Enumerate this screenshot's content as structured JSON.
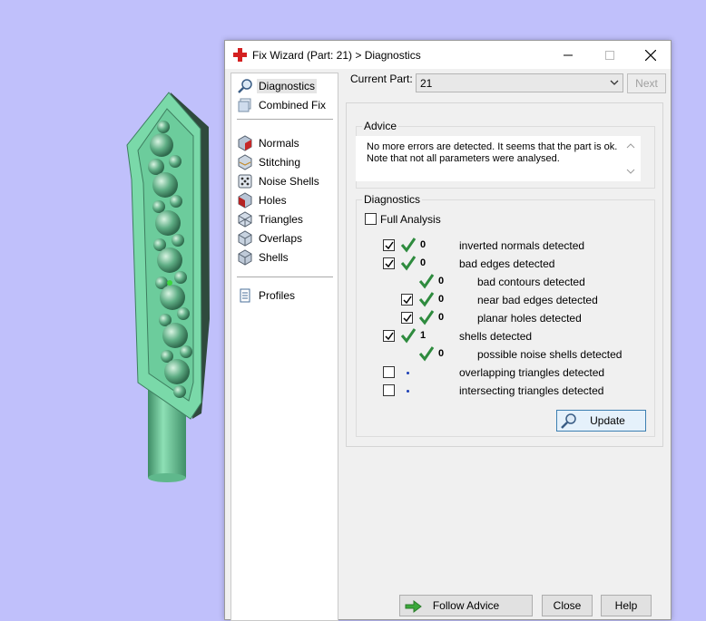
{
  "window": {
    "title": "Fix Wizard (Part: 21) > Diagnostics",
    "minimize_icon": "minimize-icon",
    "maximize_icon": "maximize-icon",
    "close_icon": "close-icon"
  },
  "sidebar": {
    "items": [
      {
        "label": "Diagnostics",
        "icon": "magnifier-icon",
        "selected": true
      },
      {
        "label": "Combined Fix",
        "icon": "cube-stack-icon"
      },
      {
        "label": "Normals",
        "icon": "cube-red-face-icon"
      },
      {
        "label": "Stitching",
        "icon": "cube-stitch-icon"
      },
      {
        "label": "Noise Shells",
        "icon": "dice-icon"
      },
      {
        "label": "Holes",
        "icon": "cube-hole-icon"
      },
      {
        "label": "Triangles",
        "icon": "triangles-cube-icon"
      },
      {
        "label": "Overlaps",
        "icon": "overlaps-cube-icon"
      },
      {
        "label": "Shells",
        "icon": "shells-cube-icon"
      },
      {
        "label": "Profiles",
        "icon": "document-icon"
      }
    ]
  },
  "current_part": {
    "label": "Current Part:",
    "value": "21"
  },
  "next_button": "Next",
  "advice": {
    "title": "Advice",
    "text": "No more errors are detected. It seems that the part is ok.\nNote that not all parameters were analysed."
  },
  "diagnostics": {
    "title": "Diagnostics",
    "full_analysis": {
      "label": "Full Analysis",
      "checked": false
    },
    "rows": [
      {
        "checked": true,
        "status": "ok",
        "count": "0",
        "label": "inverted normals detected",
        "level": 0
      },
      {
        "checked": true,
        "status": "ok",
        "count": "0",
        "label": "bad edges detected",
        "level": 0
      },
      {
        "checkbox": false,
        "status": "ok",
        "count": "0",
        "label": "bad contours detected",
        "level": 1
      },
      {
        "checked": true,
        "status": "ok",
        "count": "0",
        "label": "near bad edges detected",
        "level": 1
      },
      {
        "checked": true,
        "status": "ok",
        "count": "0",
        "label": "planar holes detected",
        "level": 1
      },
      {
        "checked": true,
        "status": "ok",
        "count": "1",
        "label": "shells detected",
        "level": 0
      },
      {
        "checkbox": false,
        "status": "ok",
        "count": "0",
        "label": "possible noise shells detected",
        "level": 1
      },
      {
        "checked": false,
        "status": "not-analysed",
        "count": "",
        "label": "overlapping triangles detected",
        "level": 0
      },
      {
        "checked": false,
        "status": "not-analysed",
        "count": "",
        "label": "intersecting triangles detected",
        "level": 0
      }
    ],
    "update_button": "Update"
  },
  "footer": {
    "follow_advice": "Follow Advice",
    "close": "Close",
    "help": "Help"
  },
  "colors": {
    "background": "#c0c0fb",
    "model": "#6cc99a",
    "check_green": "#2e8b3e",
    "accent_border": "#3c7fb1"
  }
}
